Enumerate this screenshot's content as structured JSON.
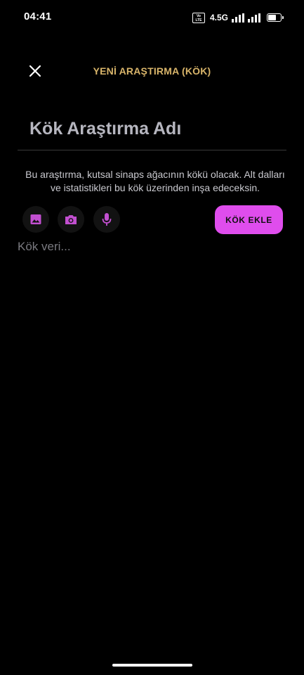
{
  "status_bar": {
    "time": "04:41",
    "volte_top": "Vo",
    "volte_bottom": "LTE",
    "network": "4.5G",
    "icons": [
      "volte-lte-badge",
      "signal-bars",
      "signal-bars",
      "battery"
    ],
    "battery_level": 0.7
  },
  "header": {
    "close_icon": "close-icon",
    "title": "YENİ ARAŞTIRMA (KÖK)"
  },
  "form": {
    "name_placeholder": "Kök Araştırma Adı",
    "description": "Bu araştırma, kutsal sinaps ağacının kökü olacak. Alt dalları ve istatistikleri bu kök üzerinden inşa edeceksin.",
    "data_placeholder": "Kök veri..."
  },
  "toolbar": {
    "icons": [
      "image-icon",
      "camera-icon",
      "microphone-icon"
    ],
    "add_label": "KÖK EKLE"
  },
  "colors": {
    "background": "#000000",
    "accent": "#df4ded",
    "title": "#d9b56a",
    "icon": "#c24fd0"
  }
}
